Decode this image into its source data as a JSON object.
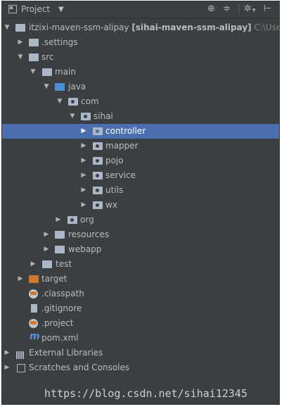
{
  "toolbar": {
    "title": "Project",
    "icons": [
      "project-icon",
      "chevron-down-icon",
      "sync-icon",
      "collapse-all-icon",
      "gear-icon",
      "hide-icon"
    ]
  },
  "tree": {
    "root_name": "itzixi-maven-ssm-alipay",
    "root_module": "[sihai-maven-ssm-alipay]",
    "root_path": "C:\\Users",
    "settings": ".settings",
    "src": "src",
    "main": "main",
    "java": "java",
    "com": "com",
    "sihai": "sihai",
    "controller": "controller",
    "mapper": "mapper",
    "pojo": "pojo",
    "service": "service",
    "utils": "utils",
    "wx": "wx",
    "org": "org",
    "resources": "resources",
    "webapp": "webapp",
    "test": "test",
    "target": "target",
    "classpath": ".classpath",
    "gitignore": ".gitignore",
    "project": ".project",
    "pom": "pom.xml",
    "external_libraries": "External Libraries",
    "scratches": "Scratches and Consoles"
  },
  "watermark": "https://blog.csdn.net/sihai12345",
  "colors": {
    "panel_bg": "#3c3f41",
    "selection": "#4b6eaf",
    "text": "#bbbbbb",
    "target_folder": "#d0782a"
  }
}
